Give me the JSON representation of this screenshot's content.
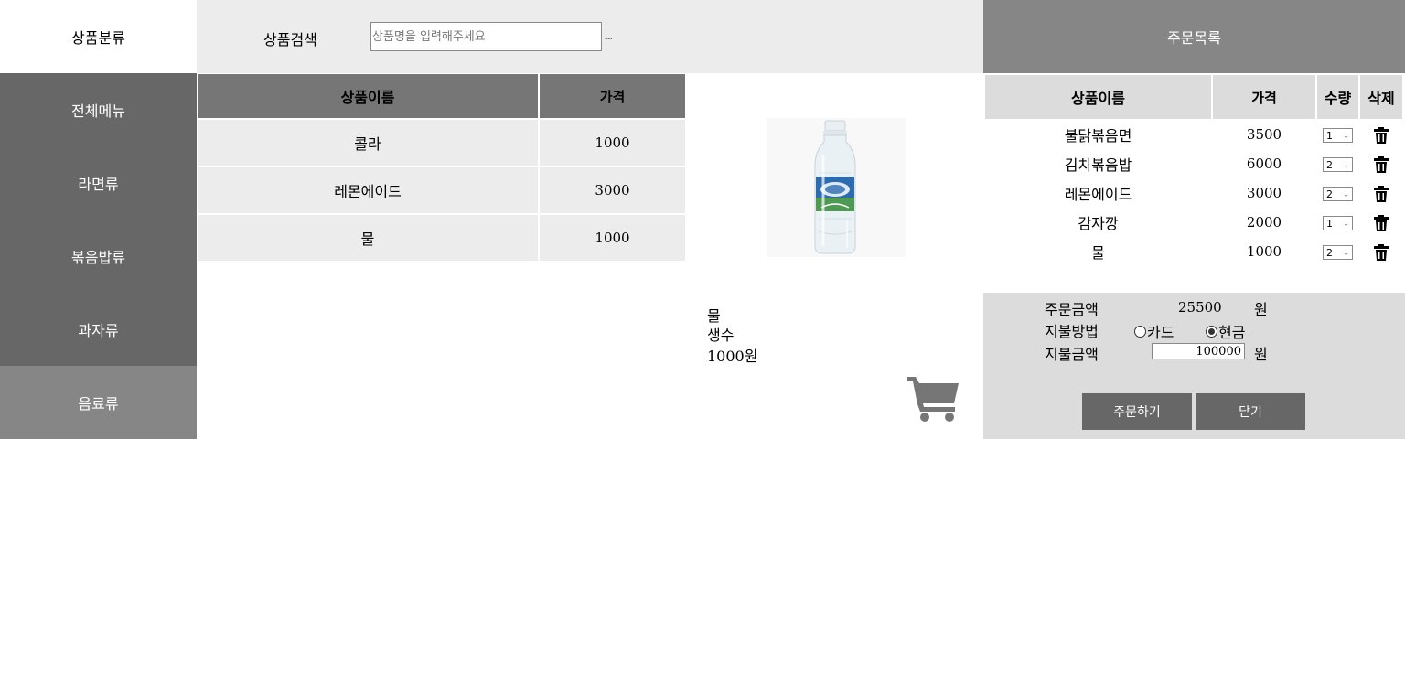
{
  "sidebar": {
    "title": "상품분류",
    "categories": [
      {
        "label": "전체메뉴",
        "active": false
      },
      {
        "label": "라면류",
        "active": false
      },
      {
        "label": "볶음밥류",
        "active": false
      },
      {
        "label": "과자류",
        "active": false
      },
      {
        "label": "음료류",
        "active": true
      }
    ]
  },
  "search": {
    "label": "상품검색",
    "placeholder": "상품명을 입력해주세요",
    "value": "",
    "dots": "....."
  },
  "products": {
    "headers": [
      "상품이름",
      "가격"
    ],
    "rows": [
      {
        "name": "콜라",
        "price": "1000"
      },
      {
        "name": "레몬에이드",
        "price": "3000"
      },
      {
        "name": "물",
        "price": "1000"
      }
    ]
  },
  "detail": {
    "name": "물",
    "description": "생수",
    "price": "1000원",
    "image_icon": "water-bottle-image",
    "cart_icon": "shopping-cart-icon"
  },
  "order": {
    "title": "주문목록",
    "headers": [
      "상품이름",
      "가격",
      "수량",
      "삭제"
    ],
    "items": [
      {
        "name": "불닭볶음면",
        "price": "3500",
        "qty": "1"
      },
      {
        "name": "김치볶음밥",
        "price": "6000",
        "qty": "2"
      },
      {
        "name": "레몬에이드",
        "price": "3000",
        "qty": "2"
      },
      {
        "name": "감자깡",
        "price": "2000",
        "qty": "1"
      },
      {
        "name": "물",
        "price": "1000",
        "qty": "2"
      }
    ],
    "delete_icon": "trash-icon"
  },
  "summary": {
    "amount_label": "주문금액",
    "amount_value": "25500",
    "unit": "원",
    "method_label": "지불방법",
    "methods": [
      {
        "label": "카드",
        "selected": false
      },
      {
        "label": "현금",
        "selected": true
      }
    ],
    "pay_label": "지불금액",
    "pay_value": "100000",
    "order_button": "주문하기",
    "close_button": "닫기"
  },
  "colors": {
    "sidebar_bg": "#676767",
    "sidebar_active": "#868686",
    "panel_bg": "#ececec",
    "table_header": "#767676",
    "order_header": "#868686",
    "summary_bg": "#dcdcdc",
    "button_bg": "#676767",
    "cart_icon": "#767676"
  }
}
